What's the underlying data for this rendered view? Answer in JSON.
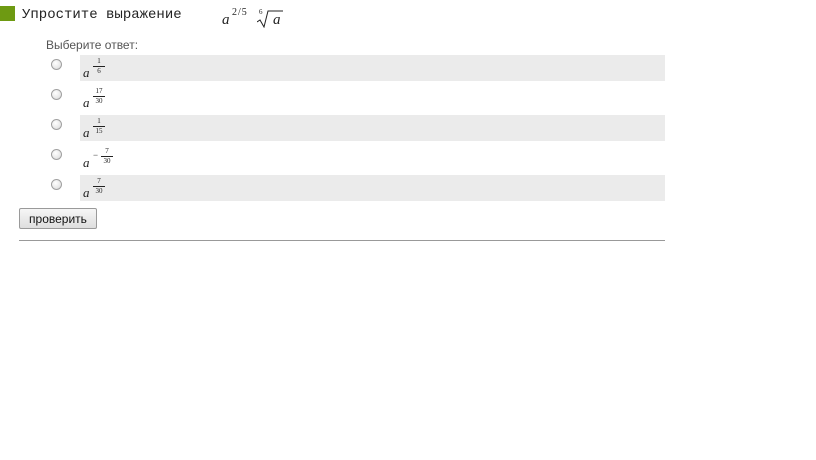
{
  "question": {
    "text": "Упростите выражение",
    "expr": {
      "base": "a",
      "exponent": "2/5",
      "root_index": "6",
      "radicand": "a"
    }
  },
  "answer_prompt": "Выберите ответ:",
  "options": [
    {
      "base": "a",
      "sign": "",
      "num": "1",
      "den": "6"
    },
    {
      "base": "a",
      "sign": "",
      "num": "17",
      "den": "30"
    },
    {
      "base": "a",
      "sign": "",
      "num": "1",
      "den": "15"
    },
    {
      "base": "a",
      "sign": "−",
      "num": "7",
      "den": "30"
    },
    {
      "base": "a",
      "sign": "",
      "num": "7",
      "den": "30"
    }
  ],
  "check_button_label": "проверить",
  "colors": {
    "marker": "#6e9a12",
    "row_shade": "#ebebeb",
    "divider": "#999999"
  }
}
